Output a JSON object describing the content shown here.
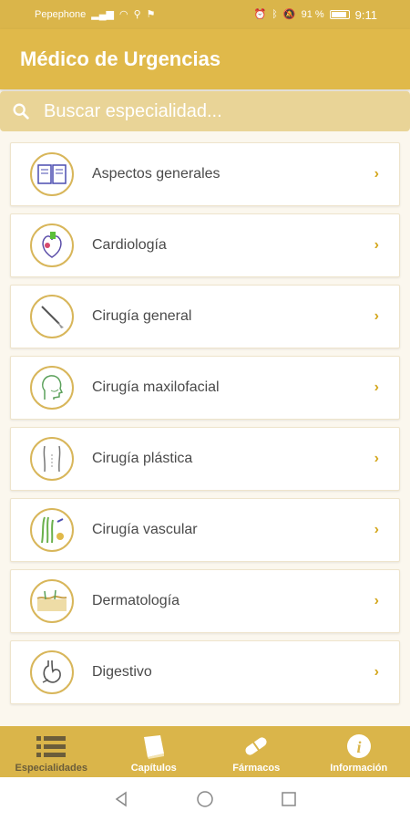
{
  "status_bar": {
    "carrier": "Pepephone",
    "battery": "91 %",
    "time": "9:11"
  },
  "app_title": "Médico de Urgencias",
  "search": {
    "placeholder": "Buscar especialidad..."
  },
  "specialties": [
    {
      "label": "Aspectos generales",
      "icon": "book-icon"
    },
    {
      "label": "Cardiología",
      "icon": "heart-icon"
    },
    {
      "label": "Cirugía general",
      "icon": "scalpel-icon"
    },
    {
      "label": "Cirugía maxilofacial",
      "icon": "head-icon"
    },
    {
      "label": "Cirugía plástica",
      "icon": "torso-icon"
    },
    {
      "label": "Cirugía vascular",
      "icon": "vessels-icon"
    },
    {
      "label": "Dermatología",
      "icon": "skin-icon"
    },
    {
      "label": "Digestivo",
      "icon": "stomach-icon"
    }
  ],
  "bottom_nav": [
    {
      "label": "Especialidades",
      "icon": "list-icon",
      "active": true
    },
    {
      "label": "Capítulos",
      "icon": "book-closed-icon",
      "active": false
    },
    {
      "label": "Fármacos",
      "icon": "pill-icon",
      "active": false
    },
    {
      "label": "Información",
      "icon": "info-icon",
      "active": false
    }
  ],
  "colors": {
    "primary": "#e0b94a",
    "search_bg": "#e9d497",
    "accent": "#d4a81f",
    "background": "#fbf7ee"
  }
}
